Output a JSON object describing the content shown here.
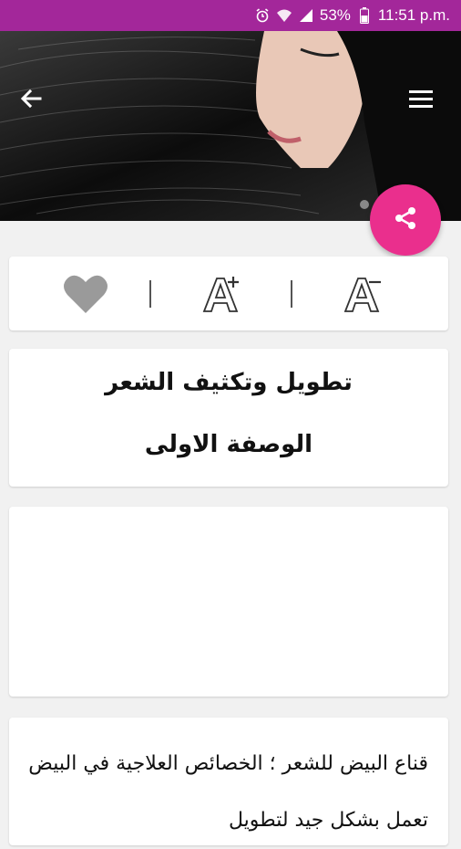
{
  "status_bar": {
    "battery": "53%",
    "time": "11:51 p.m.",
    "icons": [
      "alarm-icon",
      "wifi-icon",
      "signal-icon",
      "battery-icon"
    ]
  },
  "header": {
    "back_icon": "arrow-left-icon",
    "menu_icon": "hamburger-menu-icon"
  },
  "share": {
    "icon": "share-icon",
    "color": "#ea2f8d"
  },
  "toolbar": {
    "items": [
      "favorite-heart-icon",
      "font-increase-icon",
      "font-decrease-icon"
    ]
  },
  "article": {
    "title": "تطويل وتكثيف الشعر",
    "subtitle": "الوصفة الاولى",
    "body": "قناع البيض للشعر ؛ الخصائص العلاجية في البيض تعمل بشكل جيد لتطويل"
  },
  "colors": {
    "status_bar": "#a3279a",
    "background": "#f1f1f1",
    "accent": "#ea2f8d"
  }
}
